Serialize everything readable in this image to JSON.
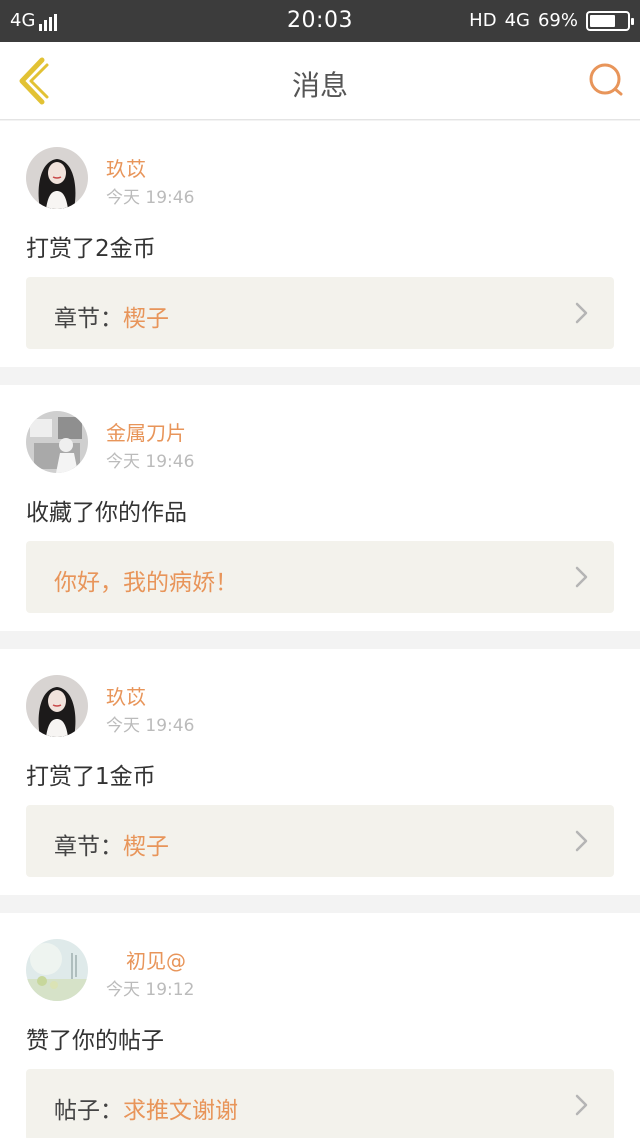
{
  "status_bar": {
    "network": "4G",
    "time": "20:03",
    "hd": "HD",
    "network_right": "4G",
    "battery_text": "69%",
    "battery_level": 0.69
  },
  "nav": {
    "title": "消息"
  },
  "messages": [
    {
      "user": "玖苡",
      "time": "今天 19:46",
      "action": "打赏了2金币",
      "ref_label": "章节：",
      "ref_value": "楔子"
    },
    {
      "user": "金属刀片",
      "time": "今天 19:46",
      "action": "收藏了你的作品",
      "ref_label": "",
      "ref_value": "你好，我的病娇！"
    },
    {
      "user": "玖苡",
      "time": "今天 19:46",
      "action": "打赏了1金币",
      "ref_label": "章节：",
      "ref_value": "楔子"
    },
    {
      "user": "初见@",
      "time": "今天 19:12",
      "action": "赞了你的帖子",
      "ref_label": "帖子：",
      "ref_value": "求推文谢谢"
    }
  ],
  "colors": {
    "accent": "#e8955a",
    "status_bar": "#3c3c3c",
    "ref_bg": "#f3f2ec",
    "back_icon": "#e2c234"
  }
}
